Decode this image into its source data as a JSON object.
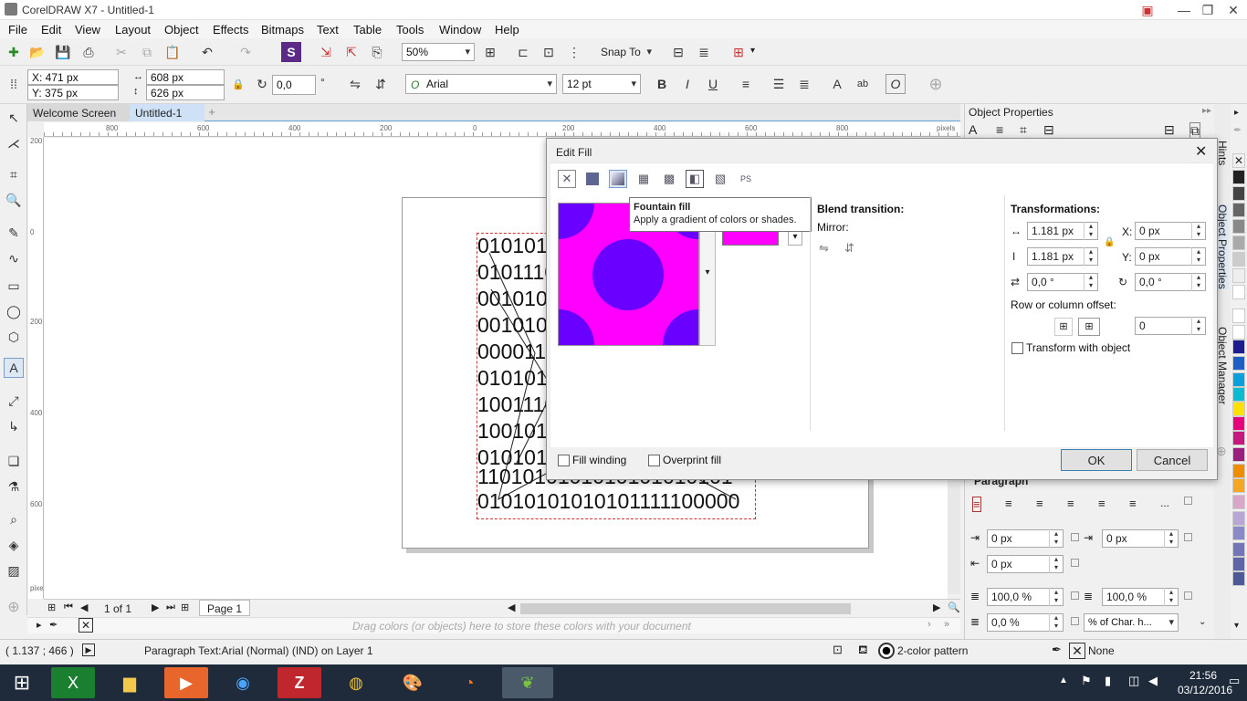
{
  "window": {
    "title": "CorelDRAW X7 - Untitled-1"
  },
  "menu": [
    "File",
    "Edit",
    "View",
    "Layout",
    "Object",
    "Effects",
    "Bitmaps",
    "Text",
    "Table",
    "Tools",
    "Window",
    "Help"
  ],
  "standard_bar": {
    "zoom": "50%",
    "snap_to": "Snap To"
  },
  "property_bar": {
    "x": "X: 471 px",
    "y": "Y: 375 px",
    "w": "608 px",
    "h": "626 px",
    "angle": "0,0",
    "deg": "°",
    "font": "Arial",
    "font_size": "12 pt"
  },
  "doc_tabs": [
    "Welcome Screen",
    "Untitled-1"
  ],
  "hruler_ticks": [
    "800",
    "600",
    "400",
    "200",
    "0",
    "200",
    "400",
    "600",
    "800",
    "pixels"
  ],
  "vruler_ticks": [
    "200",
    "0",
    "200",
    "400",
    "600",
    "pixels"
  ],
  "page_text": [
    "0101010",
    "0101110",
    "0010100",
    "0010100",
    "0000111",
    "0101010",
    "1001110",
    "1001010",
    "0101010",
    "1101010101010101010101",
    "01010101010101111100000"
  ],
  "page_nav": {
    "current": "1 of 1",
    "page_tab": "Page 1"
  },
  "colorbar_hint": "Drag colors (or objects) here to store these colors with your document",
  "status": {
    "coords": "( 1.137 ; 466 )",
    "info": "Paragraph Text:Arial (Normal) (IND) on Layer 1",
    "fill": "2-color pattern",
    "outline": "None"
  },
  "taskbar": {
    "time": "21:56",
    "date": "03/12/2016"
  },
  "docker": {
    "title": "Object Properties",
    "paragraph": "Paragraph",
    "ellipsis": "...",
    "fields": [
      "0 px",
      "0 px",
      "0 px",
      "100,0 %",
      "100,0 %",
      "0,0 %",
      "% of Char. h..."
    ]
  },
  "vertical_tabs": [
    "Hints",
    "Object Properties",
    "Object Manager"
  ],
  "palette": [
    "#ffffff",
    "#222222",
    "#444444",
    "#666666",
    "#888888",
    "#aaaaaa",
    "#cccccc",
    "#eeeeee",
    "#ffffff",
    "#1d1d8f",
    "#1b5fc4",
    "#0aa0dc",
    "#0bbbd0",
    "#ffe100",
    "#e6007e",
    "#c5197d",
    "#9b1f7c",
    "#f08c00",
    "#f5a623",
    "#d8a7c8",
    "#b7a6d6",
    "#8a8ac8",
    "#7474b8",
    "#5e66a8",
    "#4d5a98"
  ],
  "dialog": {
    "title": "Edit Fill",
    "close": "✕",
    "tooltip_title": "Fountain fill",
    "tooltip_text": "Apply a gradient of colors or shades.",
    "blend": "Blend transition:",
    "mirror": "Mirror:",
    "transformations": "Transformations:",
    "width": "1.181 px",
    "height": "1.181 px",
    "x_label": "X:",
    "y_label": "Y:",
    "x": "0 px",
    "y": "0 px",
    "skew": "0,0 °",
    "rotate": "0,0 °",
    "offset_label": "Row or column offset:",
    "offset": "0",
    "transform_with_object": "Transform with object",
    "fill_winding": "Fill winding",
    "overprint_fill": "Overprint fill",
    "ok": "OK",
    "cancel": "Cancel",
    "pattern_colors": {
      "background": "#ff00ff",
      "dots": "#6a00ff"
    }
  }
}
